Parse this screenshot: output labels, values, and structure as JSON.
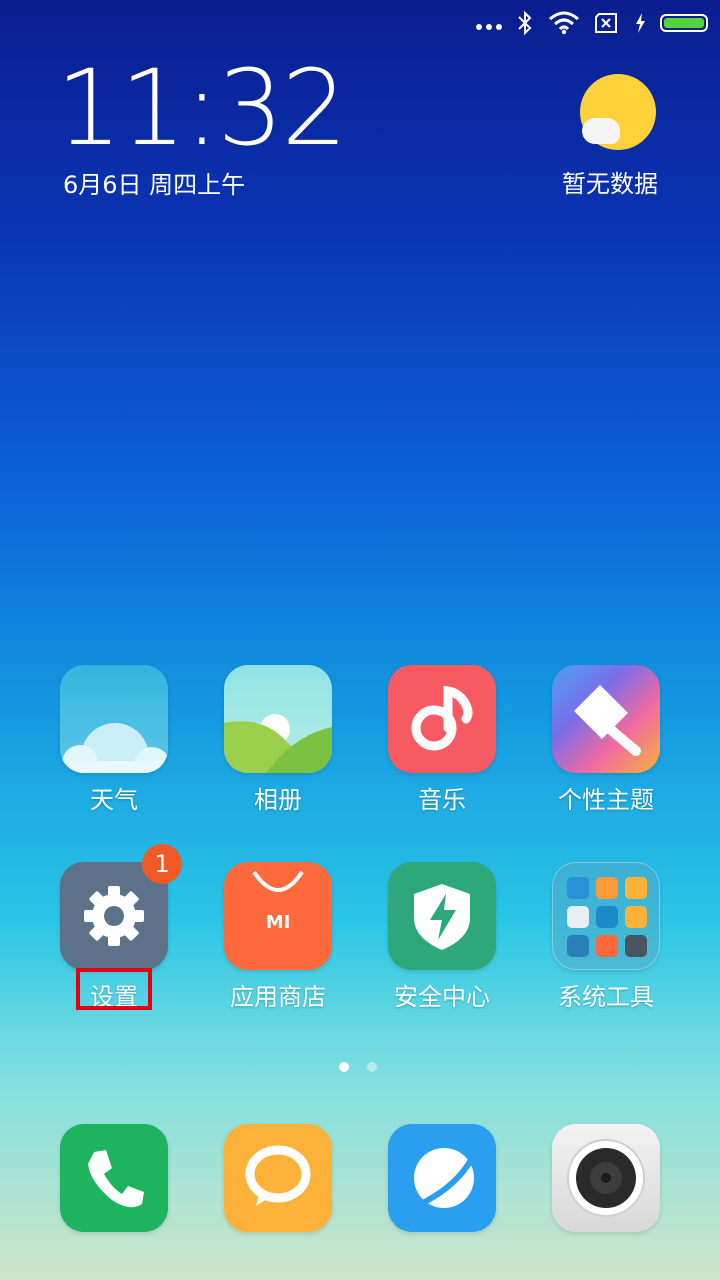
{
  "status": {
    "battery_level": 1.0,
    "charging": true
  },
  "clock": {
    "time": "11:32",
    "date": "6月6日 周四上午"
  },
  "weather_widget": {
    "text": "暂无数据"
  },
  "apps_row1": [
    {
      "label": "天气",
      "icon": "weather-icon"
    },
    {
      "label": "相册",
      "icon": "gallery-icon"
    },
    {
      "label": "音乐",
      "icon": "music-icon"
    },
    {
      "label": "个性主题",
      "icon": "themes-icon"
    }
  ],
  "apps_row2": [
    {
      "label": "设置",
      "icon": "settings-icon",
      "badge": "1"
    },
    {
      "label": "应用商店",
      "icon": "app-store-icon",
      "icon_text": "MI"
    },
    {
      "label": "安全中心",
      "icon": "security-icon"
    },
    {
      "label": "系统工具",
      "icon": "folder-icon"
    }
  ],
  "dock": [
    {
      "icon": "phone-icon"
    },
    {
      "icon": "messages-icon"
    },
    {
      "icon": "browser-icon"
    },
    {
      "icon": "camera-icon"
    }
  ],
  "pager": {
    "pages": 2,
    "current": 1
  },
  "colors": {
    "settings": "#5b7289",
    "store": "#ff6a3d",
    "security": "#2ea77a",
    "music": "#f65a63",
    "phone": "#1db35f",
    "messages": "#ffb23a",
    "browser": "#2a9ff0",
    "camera": "#e6e6e6",
    "badge": "#f15a24",
    "highlight": "#e60012"
  }
}
